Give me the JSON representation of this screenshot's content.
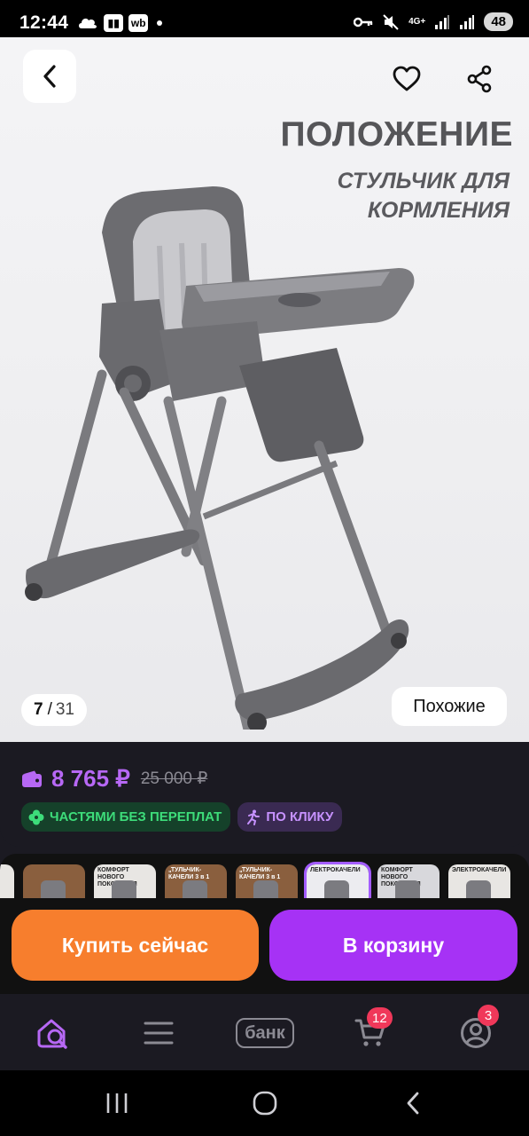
{
  "status_bar": {
    "time": "12:44",
    "app_icons": [
      "cloud-icon",
      "wb-tab-icon",
      "wb"
    ],
    "network": "4G+",
    "battery": "48"
  },
  "gallery": {
    "promo_title": "ПОЛОЖЕНИЕ",
    "promo_subtitle": "СТУЛЬЧИК ДЛЯ КОРМЛЕНИЯ",
    "current_index": "7",
    "separator": "/",
    "total": "31",
    "similar_label": "Похожие"
  },
  "price": {
    "current": "8 765 ₽",
    "old": "25 000 ₽",
    "badge_installment": "ЧАСТЯМИ БЕЗ ПЕРЕПЛАТ",
    "badge_click": "ПО КЛИКУ"
  },
  "thumbnails": [
    {
      "caption": ""
    },
    {
      "caption": "",
      "tone": "dark"
    },
    {
      "caption": "КОМФОРТ НОВОГО ПОКОЛЕНИЯ",
      "tone": "light"
    },
    {
      "caption": "„ТУЛЬЧИК-КАЧЕЛИ 3 в 1",
      "tone": "dark"
    },
    {
      "caption": "„ТУЛЬЧИК-КАЧЕЛИ 3 в 1",
      "tone": "dark"
    },
    {
      "caption": "ЛЕКТРОКАЧЕЛИ",
      "tone": "active"
    },
    {
      "caption": "КОМФОРТ НОВОГО ПОКОЛЕНИЯ",
      "tone": "grey"
    },
    {
      "caption": "ЭЛЕКТРОКАЧЕЛИ",
      "tone": "light"
    }
  ],
  "actions": {
    "buy_now": "Купить сейчас",
    "add_to_cart": "В корзину"
  },
  "bottom_nav": {
    "bank_label": "банк",
    "cart_count": "12",
    "profile_count": "3"
  },
  "colors": {
    "accent_purple": "#a632f5",
    "price_purple": "#b768f5",
    "orange": "#f77e2d",
    "badge_red": "#f0385a"
  }
}
